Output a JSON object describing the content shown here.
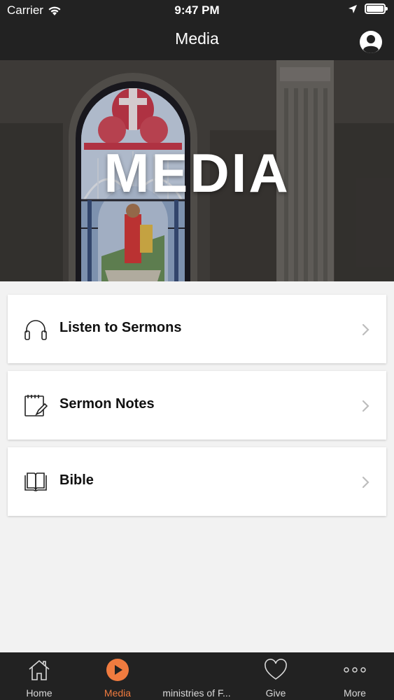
{
  "status_bar": {
    "carrier": "Carrier",
    "time": "9:47 PM"
  },
  "nav": {
    "title": "Media",
    "profile_icon": "user-circle-icon"
  },
  "hero": {
    "title": "MEDIA"
  },
  "menu": [
    {
      "label": "Listen to Sermons",
      "icon": "headphones-icon"
    },
    {
      "label": "Sermon Notes",
      "icon": "notepad-pencil-icon"
    },
    {
      "label": "Bible",
      "icon": "open-book-icon"
    }
  ],
  "tabs": [
    {
      "label": "Home",
      "icon": "home-icon"
    },
    {
      "label": "Media",
      "icon": "play-circle-icon",
      "active": true
    },
    {
      "label": "ministries of F...",
      "icon": ""
    },
    {
      "label": "Give",
      "icon": "heart-icon"
    },
    {
      "label": "More",
      "icon": "more-dots-icon"
    }
  ],
  "colors": {
    "accent": "#f07b3f",
    "bar": "#222222",
    "background": "#f2f2f2"
  }
}
